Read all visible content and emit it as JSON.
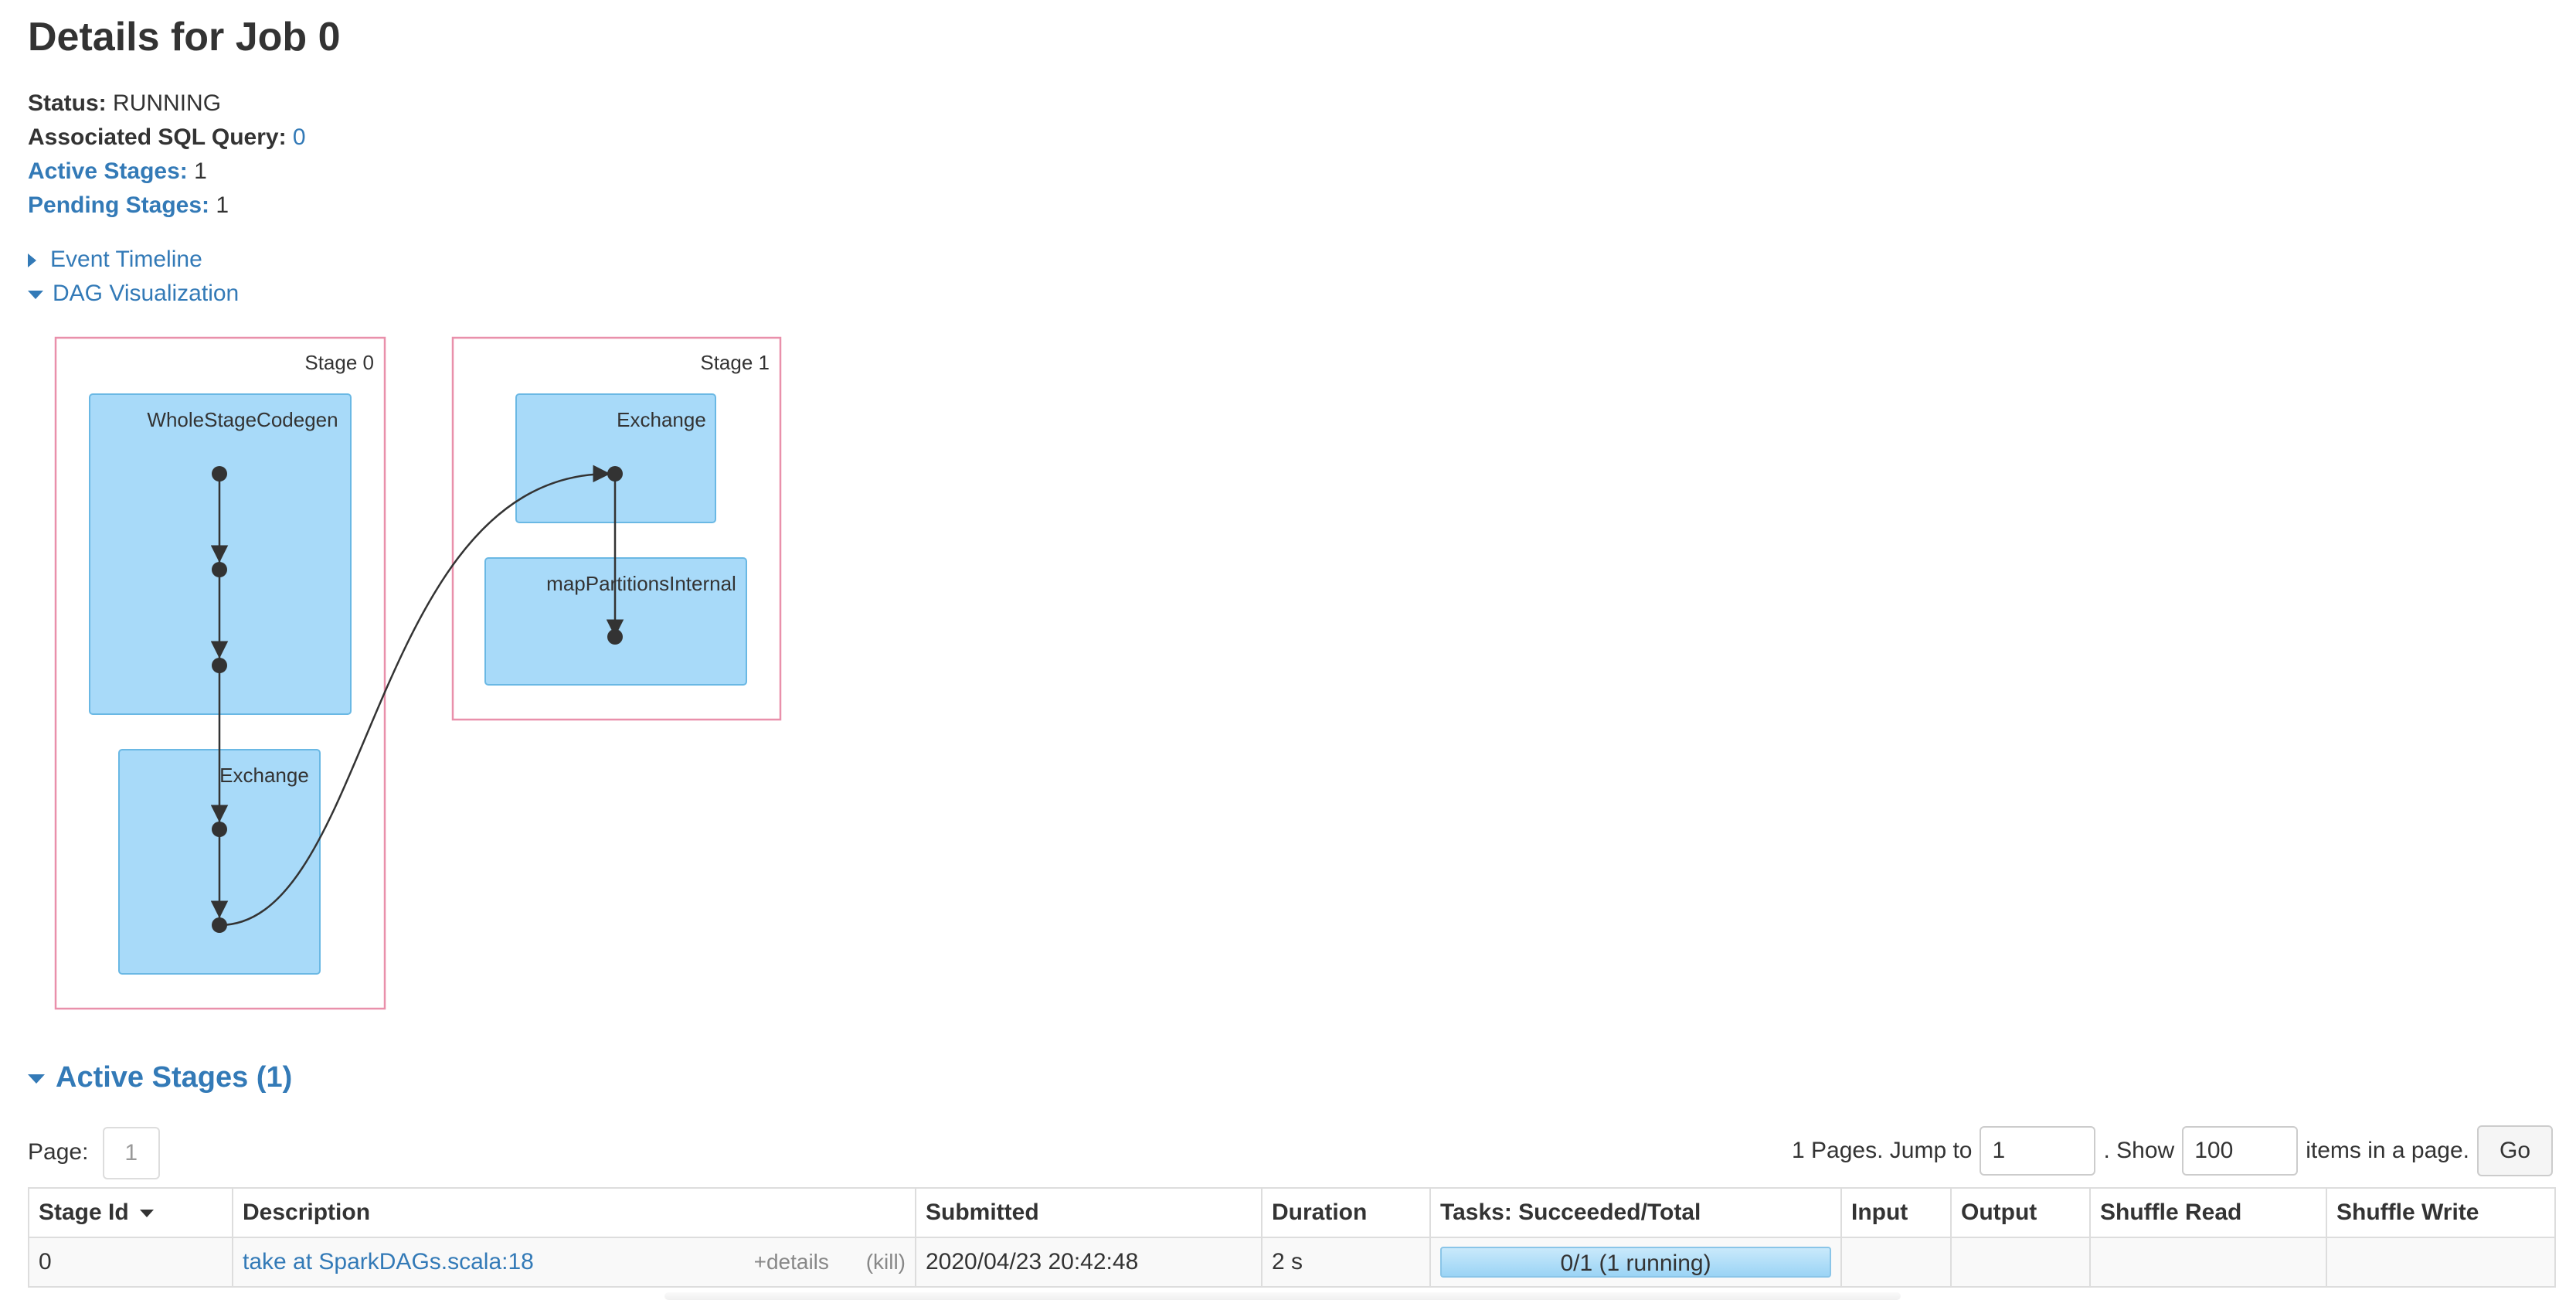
{
  "page": {
    "title": "Details for Job 0"
  },
  "summary": {
    "status_label": "Status:",
    "status_value": "RUNNING",
    "sql_label": "Associated SQL Query:",
    "sql_value": "0",
    "active_label": "Active Stages:",
    "active_value": "1",
    "pending_label": "Pending Stages:",
    "pending_value": "1"
  },
  "toggles": {
    "event_timeline": "Event Timeline",
    "dag_visualization": "DAG Visualization"
  },
  "dag": {
    "stage0": {
      "label": "Stage 0",
      "cluster_a": "WholeStageCodegen",
      "cluster_b": "Exchange"
    },
    "stage1": {
      "label": "Stage 1",
      "cluster_a": "Exchange",
      "cluster_b": "mapPartitionsInternal"
    },
    "colors": {
      "stage_border": "#e990ab",
      "cluster_fill": "#a8daf9",
      "cluster_border": "#6ab8e4",
      "node": "#333333"
    }
  },
  "active_stages": {
    "header": "Active Stages (1)",
    "pager": {
      "page_label": "Page:",
      "page_value": "1",
      "pages_text": "1 Pages. Jump to",
      "jump_value": "1",
      "show_text": ". Show",
      "show_value": "100",
      "items_text": "items in a page.",
      "go_label": "Go"
    },
    "columns": [
      "Stage Id",
      "Description",
      "Submitted",
      "Duration",
      "Tasks: Succeeded/Total",
      "Input",
      "Output",
      "Shuffle Read",
      "Shuffle Write"
    ],
    "rows": [
      {
        "stage_id": "0",
        "description": "take at SparkDAGs.scala:18",
        "details_link": "+details",
        "kill_link": "(kill)",
        "submitted": "2020/04/23 20:42:48",
        "duration": "2 s",
        "tasks_text": "0/1 (1 running)",
        "tasks_progress": 0,
        "input": "",
        "output": "",
        "shuffle_read": "",
        "shuffle_write": ""
      }
    ]
  },
  "colors": {
    "link": "#337ab7",
    "border": "#dddddd",
    "text": "#333333"
  }
}
